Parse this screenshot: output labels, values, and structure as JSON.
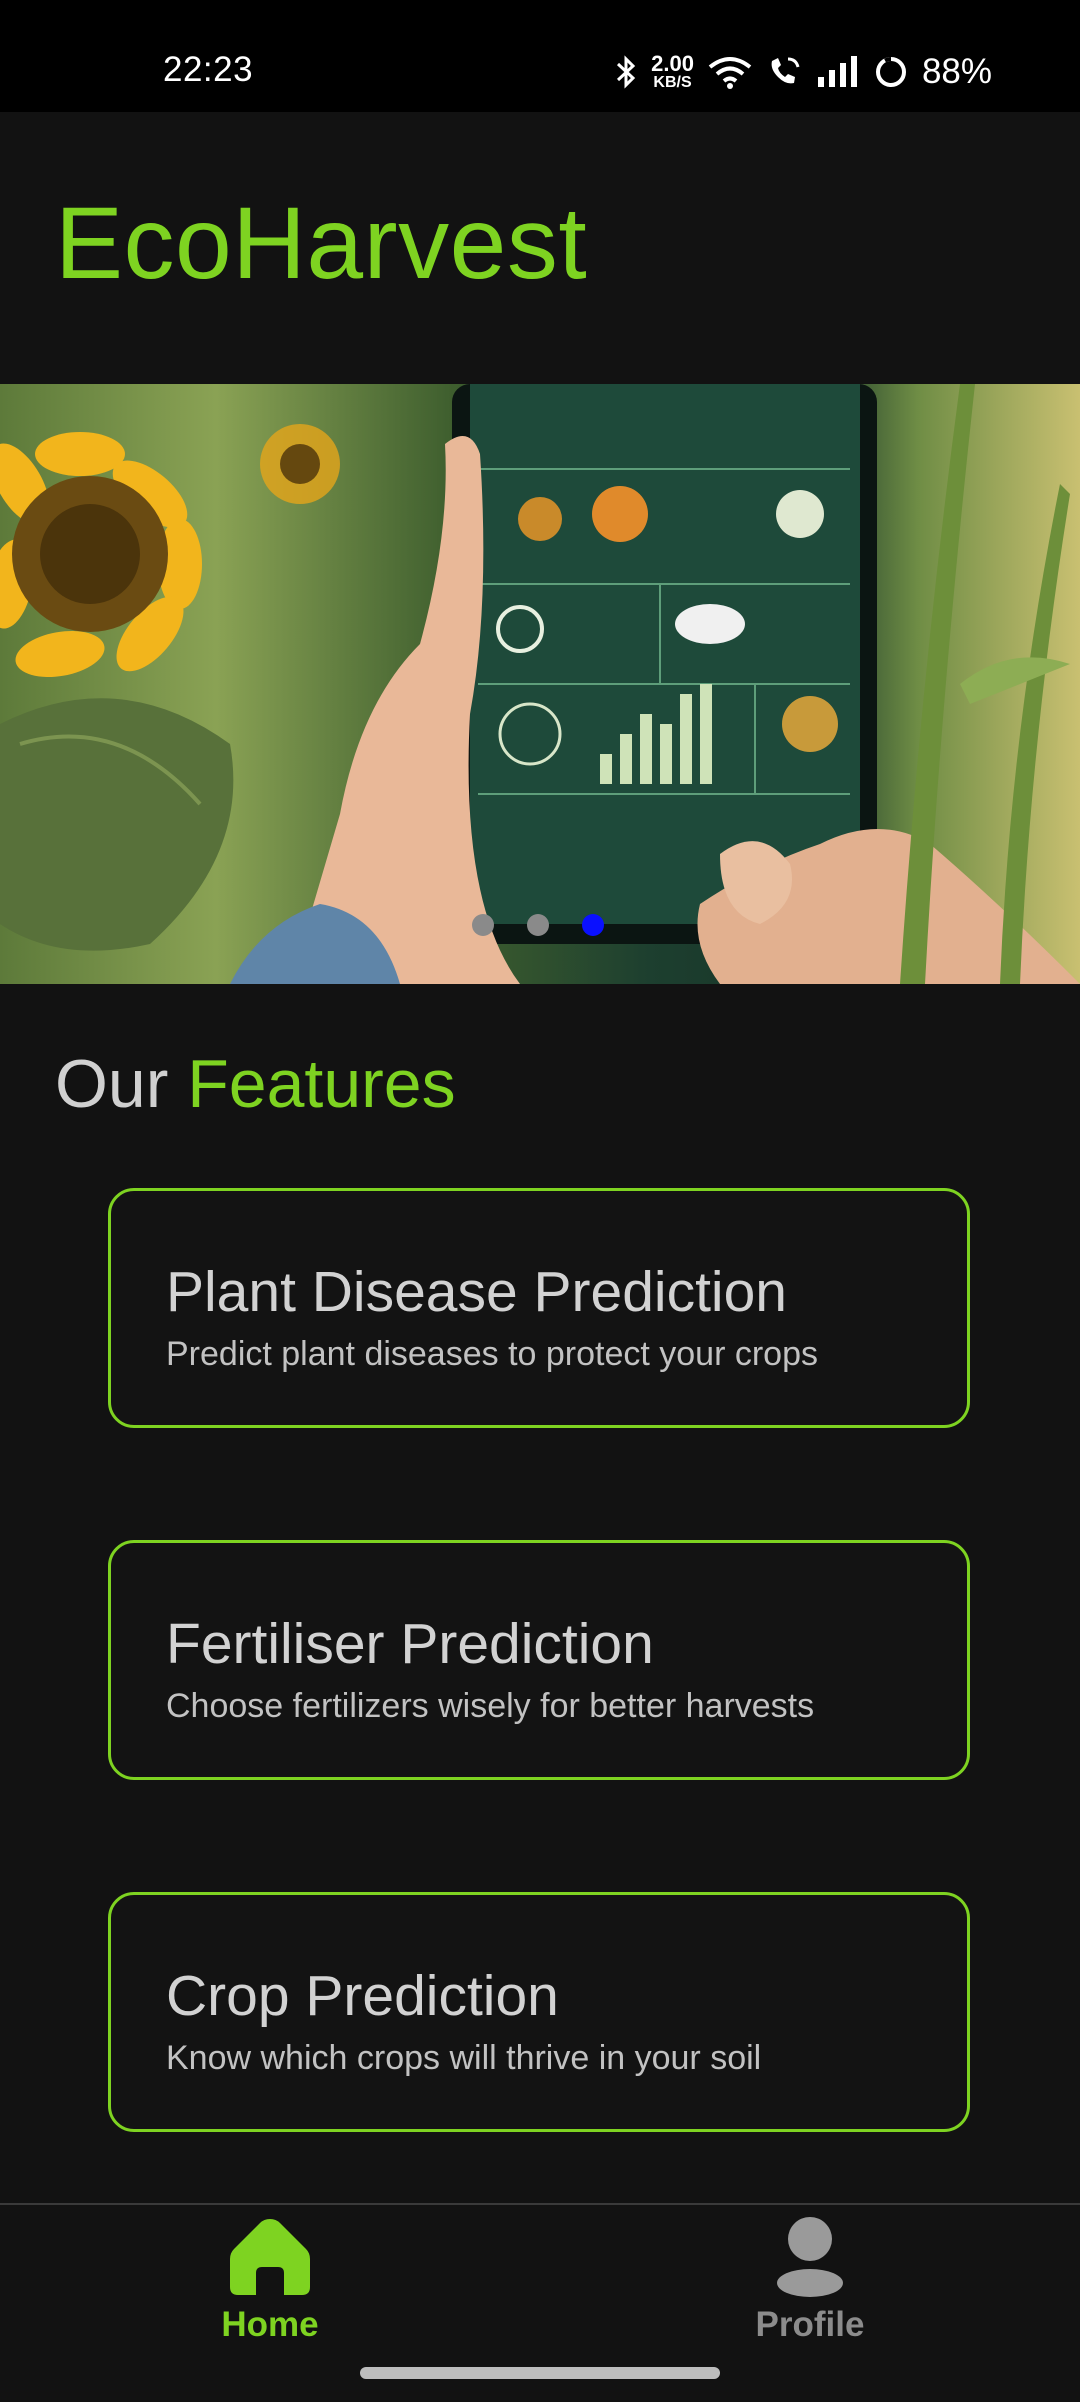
{
  "status": {
    "time": "22:23",
    "net_speed_value": "2.00",
    "net_speed_unit": "KB/S",
    "battery": "88%",
    "icons": [
      "bluetooth-icon",
      "wifi-icon",
      "wifi-calling-icon",
      "signal-icon",
      "battery-icon"
    ]
  },
  "app": {
    "title": "EcoHarvest",
    "accent_color": "#7ed321"
  },
  "banner": {
    "description_icon": "carousel-image",
    "slides_count": 3,
    "active_index": 2,
    "active_dot_color": "#0a10ff"
  },
  "features": {
    "heading_plain": "Our ",
    "heading_accent": "Features",
    "cards": [
      {
        "title": "Plant Disease Prediction",
        "desc": "Predict plant diseases to protect your crops"
      },
      {
        "title": "Fertiliser Prediction",
        "desc": "Choose fertilizers wisely for better harvests"
      },
      {
        "title": "Crop Prediction",
        "desc": "Know which crops will thrive in your soil"
      }
    ]
  },
  "nav": {
    "home_label": "Home",
    "profile_label": "Profile"
  }
}
